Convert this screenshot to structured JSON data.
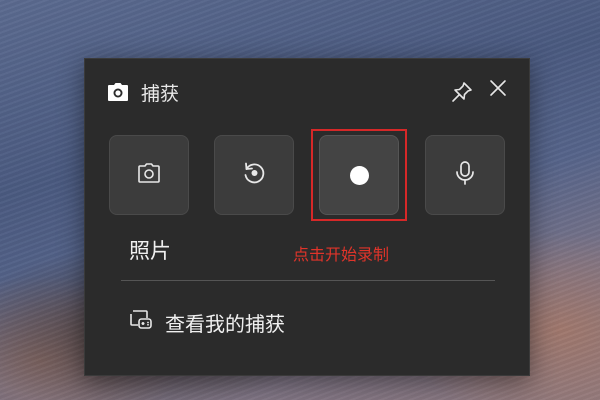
{
  "widget": {
    "title": "捕获",
    "title_icon": "camera-icon",
    "pin_icon": "pin-icon",
    "close_icon": "close-icon"
  },
  "modes": [
    {
      "name": "screenshot",
      "icon": "camera-icon"
    },
    {
      "name": "replay",
      "icon": "replay-icon"
    },
    {
      "name": "record",
      "icon": "record-icon",
      "highlighted": true
    },
    {
      "name": "microphone",
      "icon": "microphone-icon"
    }
  ],
  "labels": {
    "photo": "照片",
    "annotation": "点击开始录制",
    "annotation_color": "#e0342a",
    "highlight_color": "#d62828"
  },
  "gallery": {
    "label": "查看我的捕获",
    "icon": "gallery-icon"
  }
}
